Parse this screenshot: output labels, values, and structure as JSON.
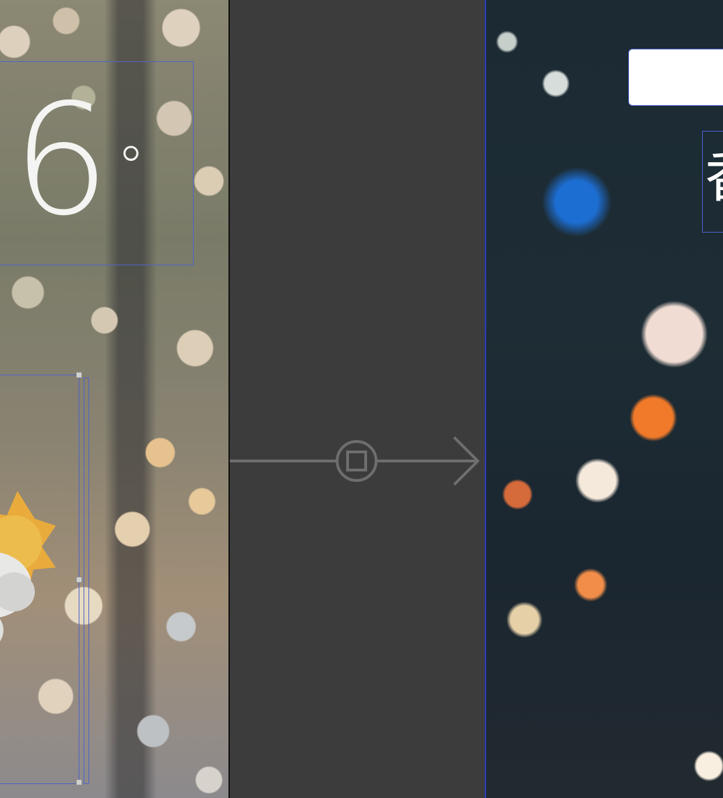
{
  "left_scene": {
    "temperature": "6",
    "degree_symbol": "°",
    "weather_icon": "partly-sunny-icon"
  },
  "right_scene": {
    "city_label": "香"
  },
  "segue": {
    "icon": "segue-connection-icon",
    "arrow": "arrow-right-icon"
  },
  "colors": {
    "canvas": "#3c3c3c",
    "selection": "#4b63d3",
    "segue_line": "#6e6e6e"
  }
}
